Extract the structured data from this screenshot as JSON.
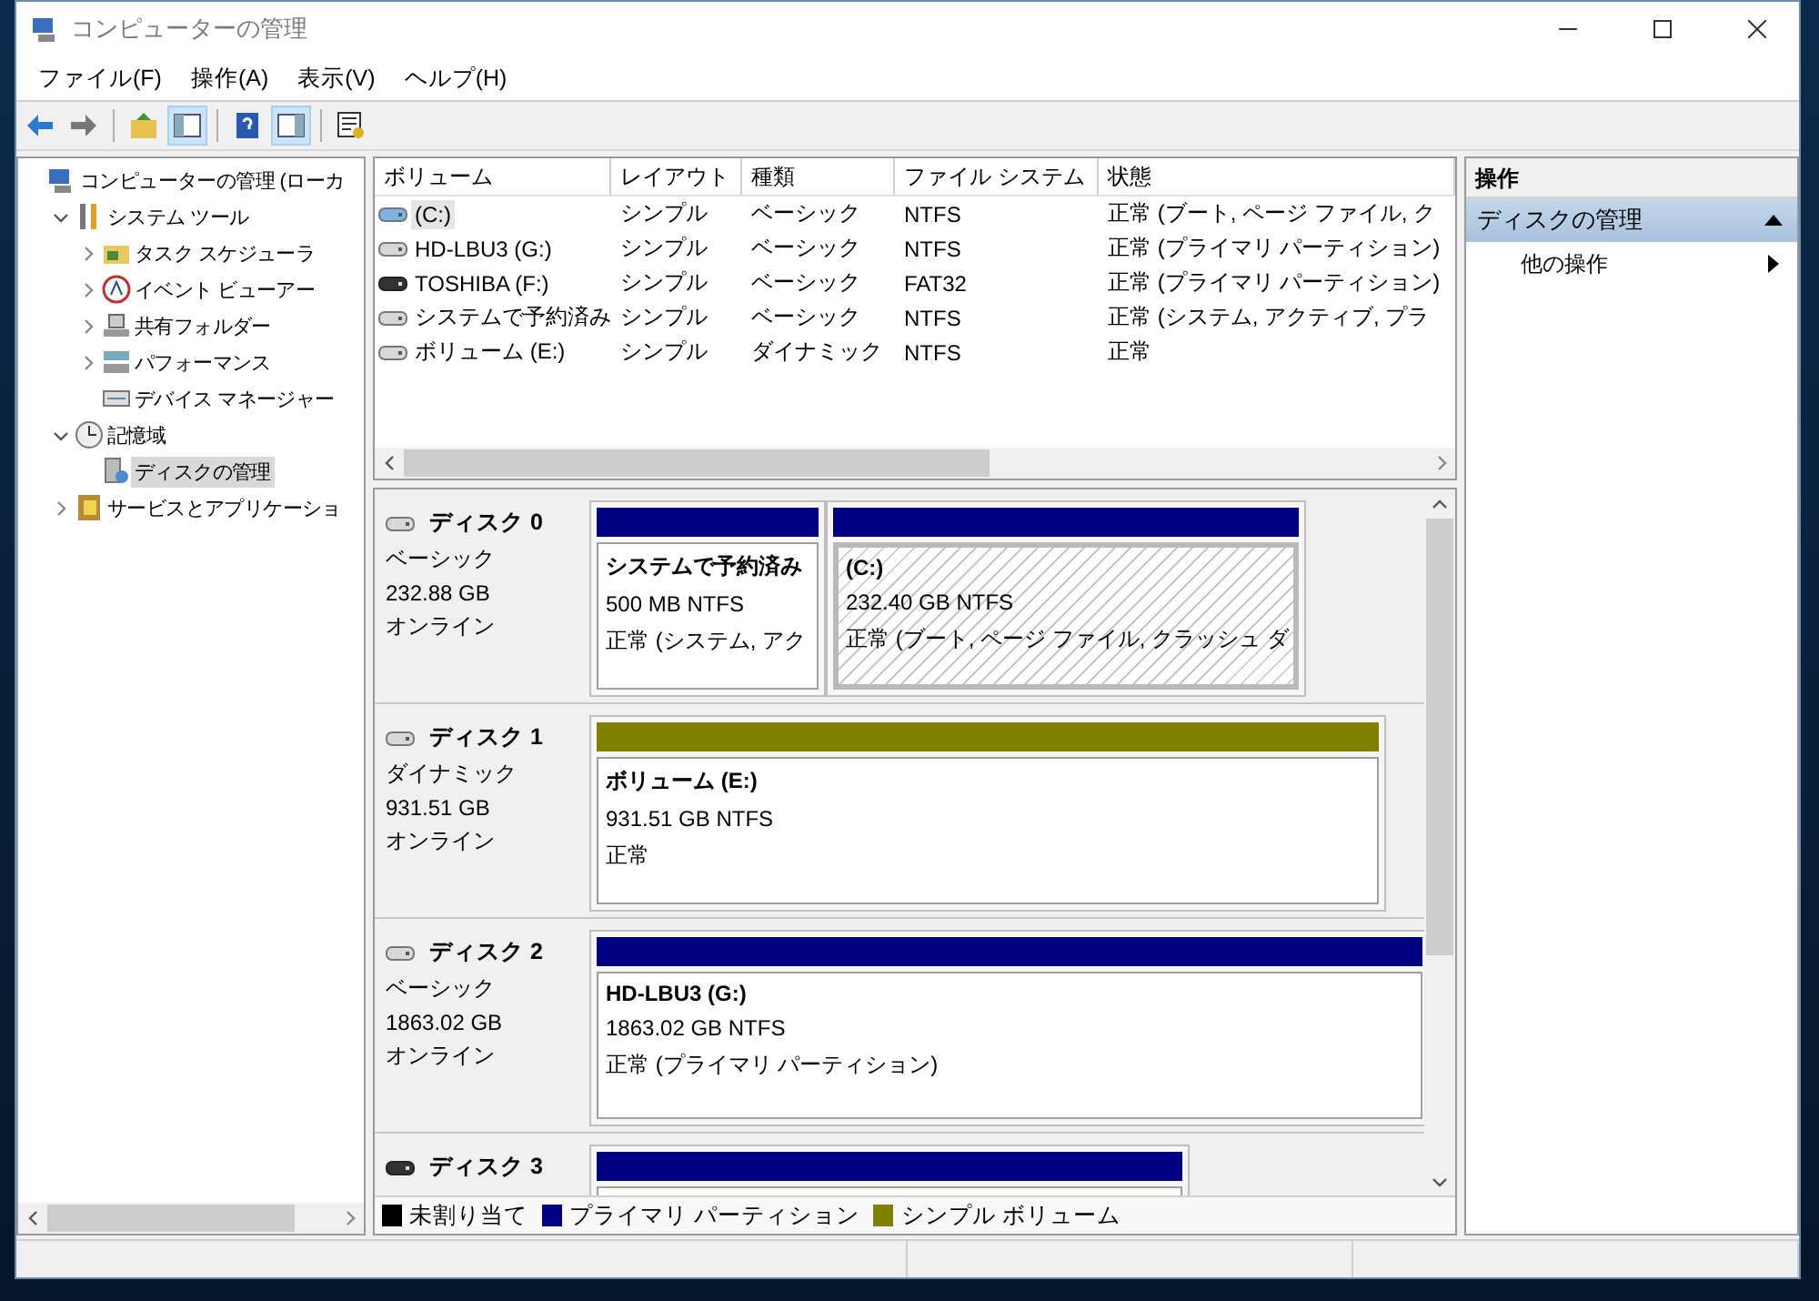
{
  "window": {
    "title": "コンピューターの管理"
  },
  "menu": [
    "ファイル(F)",
    "操作(A)",
    "表示(V)",
    "ヘルプ(H)"
  ],
  "toolbar": [
    {
      "kind": "back",
      "pressed": false
    },
    {
      "kind": "forward",
      "pressed": false
    },
    {
      "kind": "separator"
    },
    {
      "kind": "up",
      "pressed": false
    },
    {
      "kind": "tree",
      "pressed": true
    },
    {
      "kind": "separator"
    },
    {
      "kind": "help",
      "pressed": false
    },
    {
      "kind": "pane",
      "pressed": true
    },
    {
      "kind": "separator"
    },
    {
      "kind": "properties",
      "pressed": false
    }
  ],
  "tree": [
    {
      "label": "コンピューターの管理 (ローカ",
      "selected": false,
      "children": [
        {
          "label": "システム ツール",
          "expanded": true,
          "selected": false,
          "children": [
            {
              "label": "タスク スケジューラ",
              "expanded": false,
              "selected": false
            },
            {
              "label": "イベント ビューアー",
              "expanded": false,
              "selected": false
            },
            {
              "label": "共有フォルダー",
              "expanded": false,
              "selected": false
            },
            {
              "label": "パフォーマンス",
              "expanded": false,
              "selected": false
            },
            {
              "label": "デバイス マネージャー",
              "selected": false
            }
          ]
        },
        {
          "label": "記憶域",
          "expanded": true,
          "selected": false,
          "children": [
            {
              "label": "ディスクの管理",
              "selected": true
            }
          ]
        },
        {
          "label": "サービスとアプリケーショ",
          "expanded": false,
          "selected": false
        }
      ]
    }
  ],
  "table": {
    "columns": [
      "ボリューム",
      "レイアウト",
      "種類",
      "ファイル システム",
      "状態"
    ],
    "rows": [
      {
        "kind": "system",
        "selected": true,
        "cells": [
          "(C:)",
          "シンプル",
          "ベーシック",
          "NTFS",
          "正常 (ブート, ページ ファイル, ク"
        ]
      },
      {
        "kind": "disk",
        "selected": false,
        "cells": [
          "HD-LBU3 (G:)",
          "シンプル",
          "ベーシック",
          "NTFS",
          "正常 (プライマリ パーティション)"
        ]
      },
      {
        "kind": "removable",
        "selected": false,
        "cells": [
          "TOSHIBA (F:)",
          "シンプル",
          "ベーシック",
          "FAT32",
          "正常 (プライマリ パーティション)"
        ]
      },
      {
        "kind": "disk",
        "selected": false,
        "cells": [
          "システムで予約済み",
          "シンプル",
          "ベーシック",
          "NTFS",
          "正常 (システム, アクティブ, プラ"
        ]
      },
      {
        "kind": "disk",
        "selected": false,
        "cells": [
          "ボリューム (E:)",
          "シンプル",
          "ダイナミック",
          "NTFS",
          "正常"
        ]
      }
    ]
  },
  "disks": [
    {
      "kind": "fixed",
      "name": "ディスク 0",
      "type": "ベーシック",
      "size": "232.88 GB",
      "status": "オンライン",
      "partitions": [
        {
          "kind": "primary",
          "selected": false,
          "name": "システムで予約済み",
          "size": "500 MB NTFS",
          "status": "正常 (システム, アク"
        },
        {
          "kind": "primary",
          "selected": true,
          "name": "(C:)",
          "size": "232.40 GB NTFS",
          "status": "正常 (ブート, ページ ファイル, クラッシュ ダ"
        }
      ]
    },
    {
      "kind": "fixed",
      "name": "ディスク 1",
      "type": "ダイナミック",
      "size": "931.51 GB",
      "status": "オンライン",
      "partitions": [
        {
          "kind": "simple",
          "selected": false,
          "name": "ボリューム (E:)",
          "size": "931.51 GB NTFS",
          "status": "正常"
        }
      ]
    },
    {
      "kind": "fixed",
      "name": "ディスク 2",
      "type": "ベーシック",
      "size": "1863.02 GB",
      "status": "オンライン",
      "partitions": [
        {
          "kind": "primary",
          "selected": false,
          "name": "HD-LBU3 (G:)",
          "size": "1863.02 GB NTFS",
          "status": "正常 (プライマリ パーティション)"
        }
      ]
    },
    {
      "kind": "removable",
      "name": "ディスク 3",
      "partitions": [
        {
          "kind": "primary",
          "selected": false
        }
      ]
    }
  ],
  "legend": [
    {
      "label": "未割り当て",
      "color": "#000000"
    },
    {
      "label": "プライマリ パーティション",
      "color": "#000080"
    },
    {
      "label": "シンプル ボリューム",
      "color": "#808000"
    }
  ],
  "actions": {
    "header": "操作",
    "sections": [
      {
        "title": "ディスクの管理",
        "expanded": true,
        "items": [
          "他の操作"
        ]
      }
    ]
  }
}
